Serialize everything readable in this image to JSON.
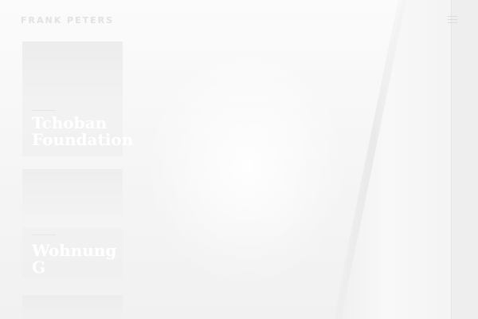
{
  "header": {
    "brand": "FRANK PETERS",
    "menu_icon": "hamburger-menu-icon"
  },
  "projects": [
    {
      "category": "",
      "title": "Tchoban Foundation"
    },
    {
      "category": "",
      "title": "Wohnung G"
    },
    {
      "category": "",
      "title": ""
    }
  ],
  "colors": {
    "background": "#f6f6f6",
    "title_text": "#ffffff",
    "brand_text": "#e2e2e2"
  }
}
